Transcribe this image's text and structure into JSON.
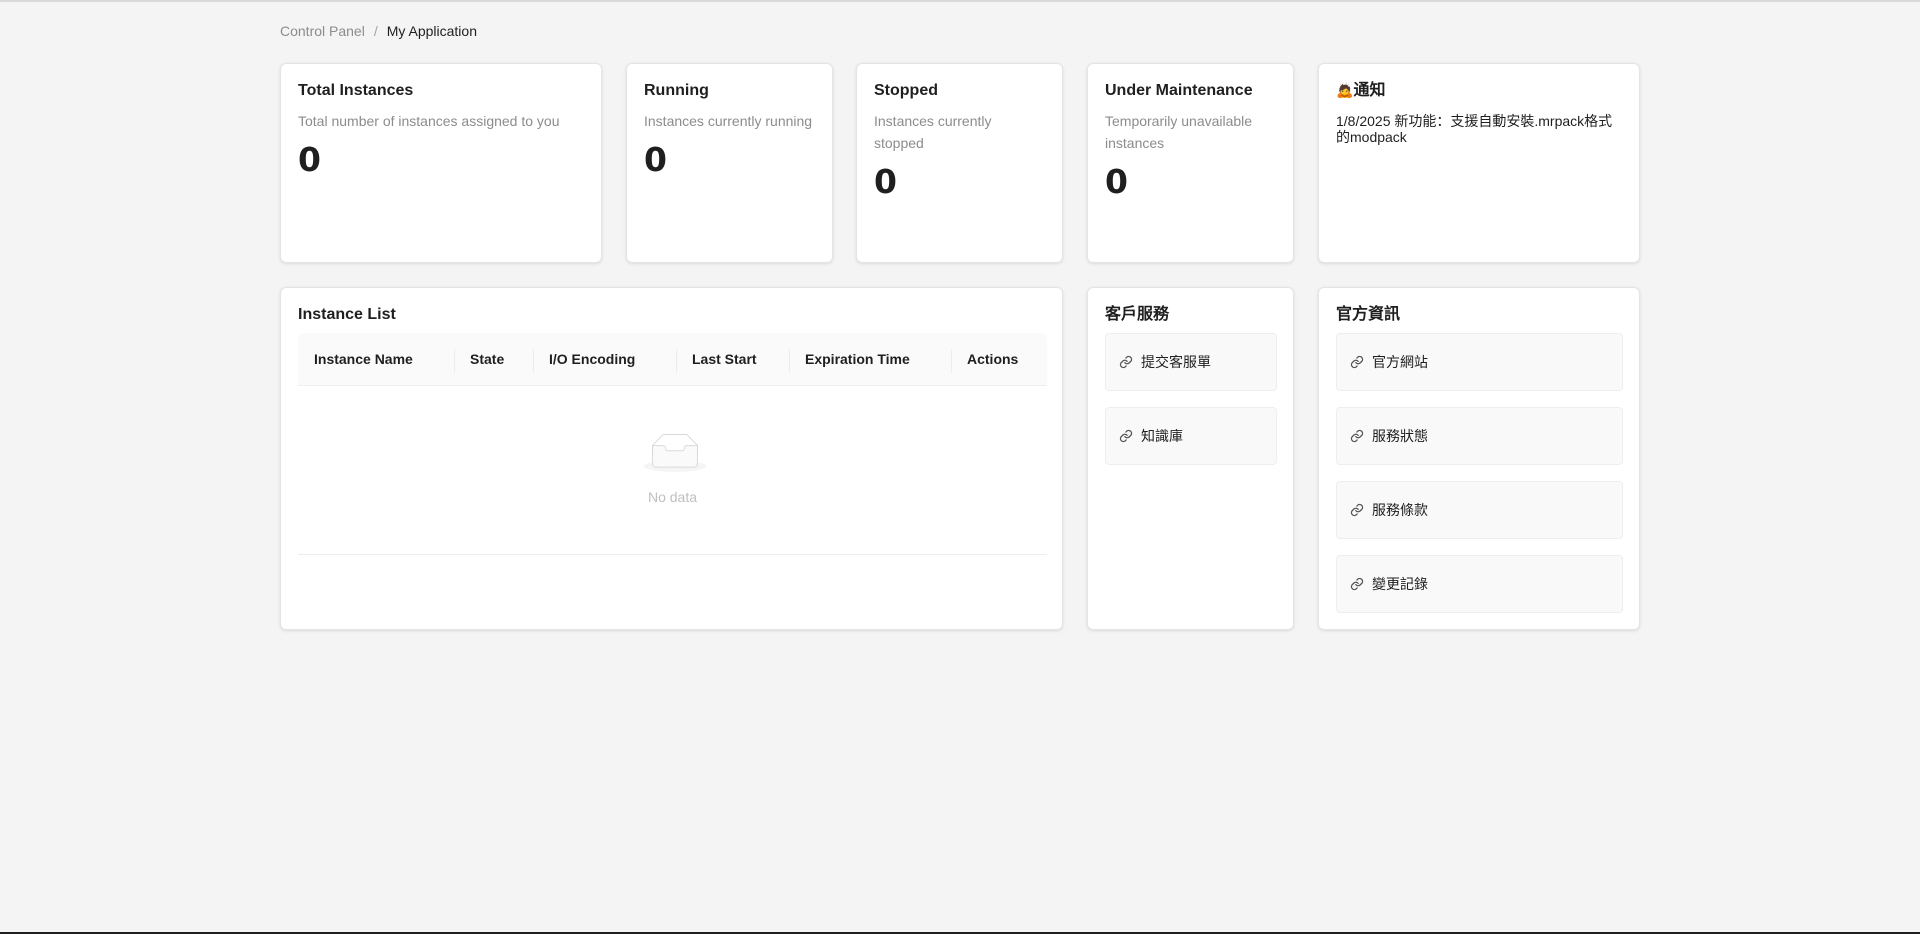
{
  "breadcrumb": {
    "parent": "Control Panel",
    "separator": "/",
    "current": "My Application"
  },
  "stats": {
    "total": {
      "title": "Total Instances",
      "subtitle": "Total number of instances assigned to you",
      "value": "0"
    },
    "running": {
      "title": "Running",
      "subtitle": "Instances currently running",
      "value": "0"
    },
    "stopped": {
      "title": "Stopped",
      "subtitle": "Instances currently stopped",
      "value": "0"
    },
    "maintenance": {
      "title": "Under Maintenance",
      "subtitle": "Temporarily unavailable instances",
      "value": "0"
    }
  },
  "notice": {
    "icon": "🙇",
    "title": "通知",
    "text": "1/8/2025 新功能：支援自動安裝.mrpack格式的modpack"
  },
  "instance_list": {
    "title": "Instance List",
    "columns": [
      "Instance Name",
      "State",
      "I/O Encoding",
      "Last Start",
      "Expiration Time",
      "Actions"
    ],
    "empty_text": "No data"
  },
  "customer_service": {
    "title": "客戶服務",
    "links": [
      {
        "icon": "link-icon",
        "label": "提交客服單"
      },
      {
        "icon": "link-icon",
        "label": "知識庫"
      }
    ]
  },
  "official_info": {
    "title": "官方資訊",
    "links": [
      {
        "icon": "link-icon",
        "label": "官方網站"
      },
      {
        "icon": "link-icon",
        "label": "服務狀態"
      },
      {
        "icon": "link-icon",
        "label": "服務條款"
      },
      {
        "icon": "link-icon",
        "label": "變更記錄"
      }
    ]
  }
}
